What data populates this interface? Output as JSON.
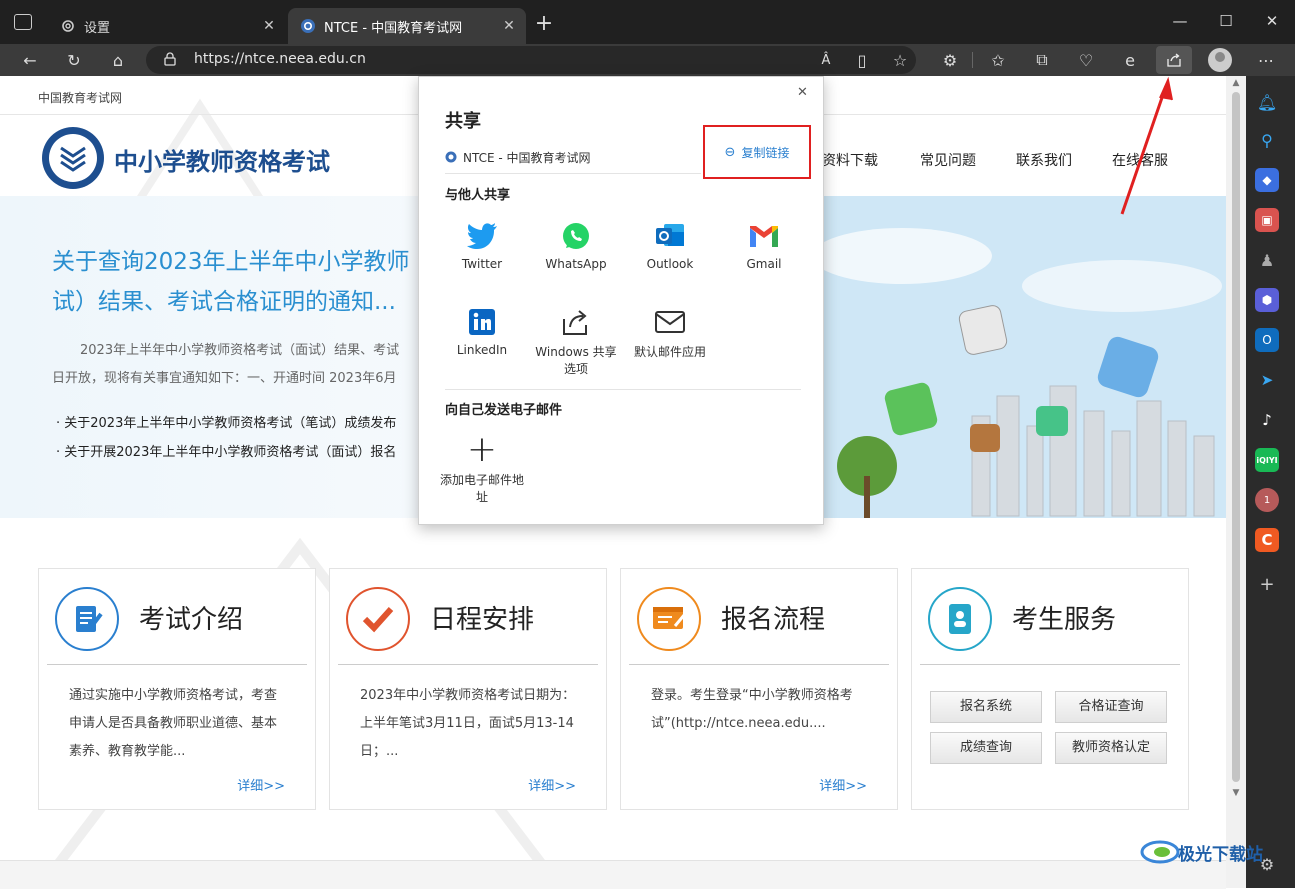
{
  "browser": {
    "tabs": [
      {
        "label": "设置",
        "icon": "gear-icon"
      },
      {
        "label": "NTCE - 中国教育考试网",
        "icon": "ntce-favicon"
      }
    ],
    "url": "https://ntce.neea.edu.cn",
    "colors": {
      "titlebar": "#202020",
      "toolbar": "#3b3b3b",
      "active_tab": "#3b3b3b"
    }
  },
  "site": {
    "top_link": "中国教育考试网",
    "logo_text": "中小学教师资格考试",
    "nav": [
      "资料下载",
      "常见问题",
      "联系我们",
      "在线客服"
    ],
    "banner": {
      "headline_line1": "关于查询2023年上半年中小学教师",
      "headline_line2": "试）结果、考试合格证明的通知...",
      "summary_line1": "2023年上半年中小学教师资格考试（面试）结果、考试",
      "summary_line2": "日开放，现将有关事宜通知如下：一、开通时间 2023年6月",
      "bullets": [
        "关于2023年上半年中小学教师资格考试（笔试）成绩发布",
        "关于开展2023年上半年中小学教师资格考试（面试）报名"
      ]
    },
    "cards": [
      {
        "title": "考试介绍",
        "icon": "exam-intro-icon",
        "color": "#2a7fcf",
        "desc": "通过实施中小学教师资格考试，考查申请人是否具备教师职业道德、基本素养、教育教学能...",
        "more": "详细>>"
      },
      {
        "title": "日程安排",
        "icon": "checkmark-icon",
        "color": "#e0542e",
        "desc": "2023年中小学教师资格考试日期为：上半年笔试3月11日，面试5月13-14日；...",
        "more": "详细>>"
      },
      {
        "title": "报名流程",
        "icon": "registration-icon",
        "color": "#ef8a1e",
        "desc": "登录。考生登录“中小学教师资格考试”(http://ntce.neea.edu....",
        "more": "详细>>"
      },
      {
        "title": "考生服务",
        "icon": "candidate-service-icon",
        "color": "#26a6c9",
        "buttons": [
          "报名系统",
          "合格证查询",
          "成绩查询",
          "教师资格认定"
        ]
      }
    ]
  },
  "share_popup": {
    "title": "共享",
    "page_title": "NTCE - 中国教育考试网",
    "copy_link": "复制链接",
    "section_others": "与他人共享",
    "apps": [
      {
        "label": "Twitter",
        "icon": "twitter-icon"
      },
      {
        "label": "WhatsApp",
        "icon": "whatsapp-icon"
      },
      {
        "label": "Outlook",
        "icon": "outlook-icon"
      },
      {
        "label": "Gmail",
        "icon": "gmail-icon"
      },
      {
        "label": "LinkedIn",
        "icon": "linkedin-icon"
      },
      {
        "label": "Windows 共享选项",
        "icon": "windows-share-icon"
      },
      {
        "label": "默认邮件应用",
        "icon": "mail-icon"
      }
    ],
    "section_self": "向自己发送电子邮件",
    "add_email": "添加电子邮件地址"
  },
  "watermark": "极光下载站"
}
